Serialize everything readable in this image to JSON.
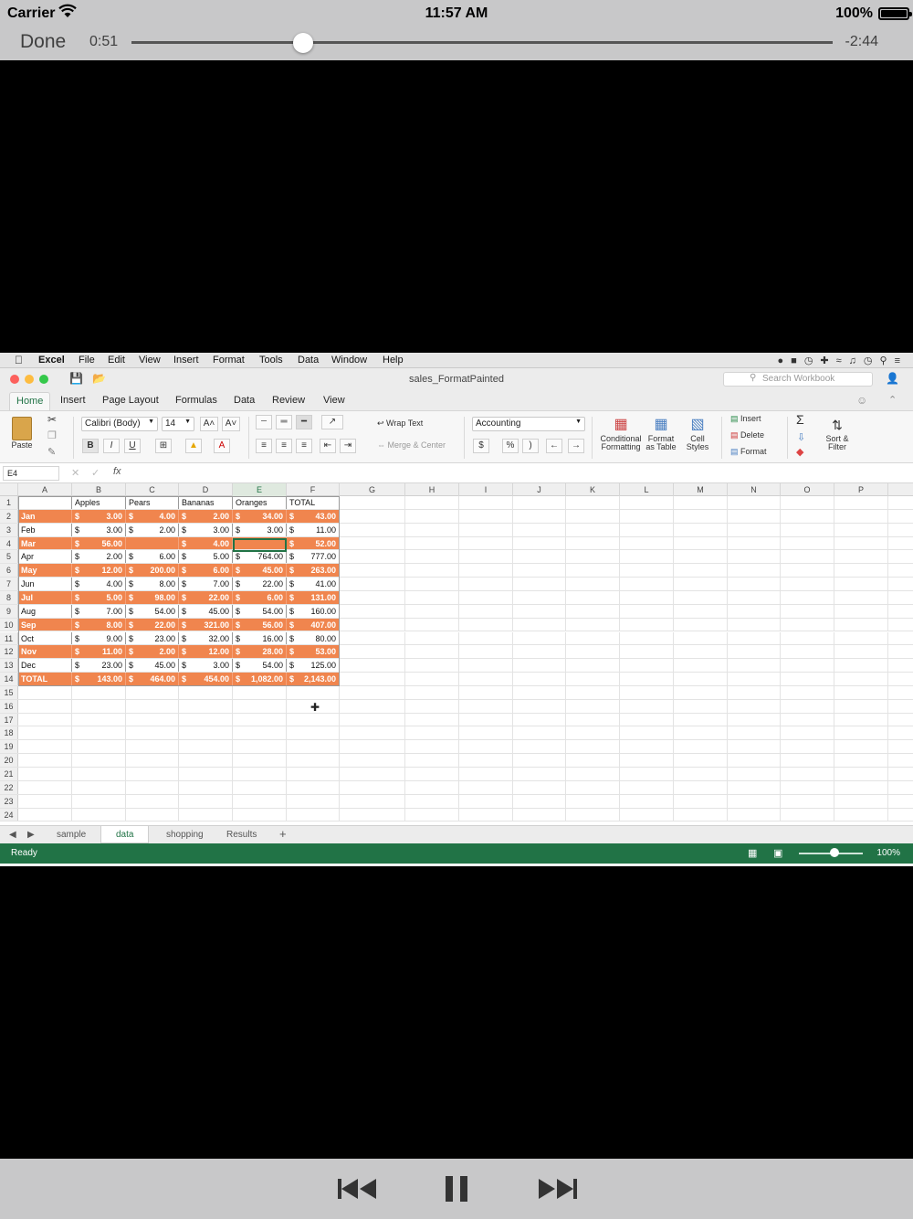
{
  "status_bar": {
    "carrier": "Carrier",
    "time": "11:57 AM",
    "battery": "100%"
  },
  "player": {
    "done_label": "Done",
    "elapsed": "0:51",
    "remaining": "-2:44",
    "progress": 0.245,
    "controls": {
      "previous": "previous-track",
      "pause": "pause",
      "next": "next-track"
    }
  },
  "excel": {
    "mac_menu": {
      "app": "Excel",
      "items": [
        "File",
        "Edit",
        "View",
        "Insert",
        "Format",
        "Tools",
        "Data",
        "Window",
        "Help"
      ]
    },
    "window_title": "sales_FormatPainted",
    "search_placeholder": "Search Workbook",
    "tabs": [
      "Home",
      "Insert",
      "Page Layout",
      "Formulas",
      "Data",
      "Review",
      "View"
    ],
    "active_tab": "Home",
    "ribbon": {
      "paste": "Paste",
      "font_name": "Calibri (Body)",
      "font_size": "14",
      "bold": "B",
      "italic": "I",
      "underline": "U",
      "wrap_text": "Wrap Text",
      "merge_center": "Merge & Center",
      "number_format": "Accounting",
      "currency": "$",
      "percent": "%",
      "comma": ")",
      "conditional_formatting": "Conditional Formatting",
      "format_as_table": "Format as Table",
      "cell_styles": "Cell Styles",
      "insert": "Insert",
      "delete": "Delete",
      "format": "Format",
      "sort_filter": "Sort & Filter",
      "grow_font": "A˄",
      "shrink_font": "A˅",
      "font_color": "A"
    },
    "name_box": "E4",
    "fx": "fx",
    "columns": [
      "A",
      "B",
      "C",
      "D",
      "E",
      "F",
      "G",
      "H",
      "I",
      "J",
      "K",
      "L",
      "M",
      "N",
      "O",
      "P"
    ],
    "selected_column": "E",
    "headers": [
      "",
      "Apples",
      "Pears",
      "Bananas",
      "Oranges",
      "TOTAL"
    ],
    "rows": [
      {
        "label": "Jan",
        "style": "orange",
        "vals": [
          "3.00",
          "4.00",
          "2.00",
          "34.00",
          "43.00"
        ]
      },
      {
        "label": "Feb",
        "style": "white",
        "vals": [
          "3.00",
          "2.00",
          "3.00",
          "3.00",
          "11.00"
        ]
      },
      {
        "label": "Mar",
        "style": "orange",
        "vals": [
          "56.00",
          "",
          "4.00",
          "",
          "52.00"
        ]
      },
      {
        "label": "Apr",
        "style": "white",
        "vals": [
          "2.00",
          "6.00",
          "5.00",
          "764.00",
          "777.00"
        ]
      },
      {
        "label": "May",
        "style": "orange",
        "vals": [
          "12.00",
          "200.00",
          "6.00",
          "45.00",
          "263.00"
        ]
      },
      {
        "label": "Jun",
        "style": "white",
        "vals": [
          "4.00",
          "8.00",
          "7.00",
          "22.00",
          "41.00"
        ]
      },
      {
        "label": "Jul",
        "style": "orange",
        "vals": [
          "5.00",
          "98.00",
          "22.00",
          "6.00",
          "131.00"
        ]
      },
      {
        "label": "Aug",
        "style": "white",
        "vals": [
          "7.00",
          "54.00",
          "45.00",
          "54.00",
          "160.00"
        ]
      },
      {
        "label": "Sep",
        "style": "orange",
        "vals": [
          "8.00",
          "22.00",
          "321.00",
          "56.00",
          "407.00"
        ]
      },
      {
        "label": "Oct",
        "style": "white",
        "vals": [
          "9.00",
          "23.00",
          "32.00",
          "16.00",
          "80.00"
        ]
      },
      {
        "label": "Nov",
        "style": "orange",
        "vals": [
          "11.00",
          "2.00",
          "12.00",
          "28.00",
          "53.00"
        ]
      },
      {
        "label": "Dec",
        "style": "white",
        "vals": [
          "23.00",
          "45.00",
          "3.00",
          "54.00",
          "125.00"
        ]
      },
      {
        "label": "TOTAL",
        "style": "orange",
        "vals": [
          "143.00",
          "464.00",
          "454.00",
          "1,082.00",
          "2,143.00"
        ]
      }
    ],
    "row_numbers": [
      "1",
      "2",
      "3",
      "4",
      "5",
      "6",
      "7",
      "8",
      "9",
      "10",
      "11",
      "12",
      "13",
      "14",
      "15",
      "16",
      "17",
      "18",
      "19",
      "20",
      "21",
      "22",
      "23",
      "24"
    ],
    "sheets": [
      "sample",
      "data",
      "shopping",
      "Results"
    ],
    "active_sheet": "data",
    "add_sheet": "+",
    "status": "Ready",
    "zoom": "100%",
    "colors": {
      "accent": "#217346",
      "highlight": "#f0854e"
    }
  }
}
